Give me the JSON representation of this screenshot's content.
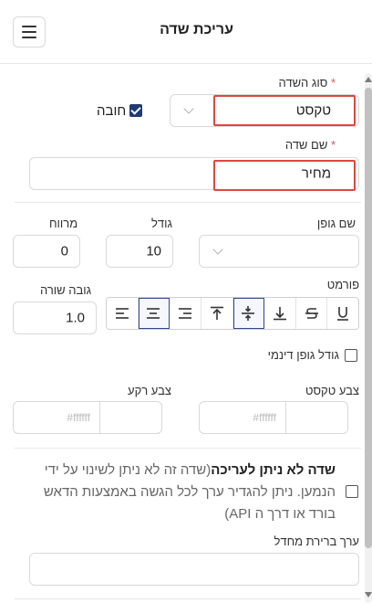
{
  "header": {
    "title": "עריכת שדה",
    "menu_icon": "hamburger-icon"
  },
  "field_type": {
    "label": "סוג השדה",
    "value": "טקסט",
    "required_label": "חובה",
    "required_checked": true
  },
  "field_name": {
    "label": "שם שדה",
    "value": "מחיר"
  },
  "font": {
    "family_label": "שם גופן",
    "size_label": "גודל",
    "size_value": "10",
    "spacing_label": "מרווח",
    "spacing_value": "0"
  },
  "format": {
    "label": "פורמט",
    "line_height_label": "גובה שורה",
    "line_height_value": "1.0",
    "buttons": [
      "underline-icon",
      "strikethrough-icon",
      "align-bottom-icon",
      "align-middle-icon",
      "align-top-icon",
      "align-right-icon",
      "align-center-icon",
      "align-left-icon"
    ],
    "active": [
      "align-middle-icon",
      "align-center-icon"
    ]
  },
  "dynamic_font": {
    "label": "גודל גופן דינמי",
    "checked": false
  },
  "colors": {
    "text_label": "צבע טקסט",
    "text_placeholder": "#ffffff",
    "bg_label": "צבע רקע",
    "bg_placeholder": "#ffffff"
  },
  "readonly": {
    "title": "שדה לא ניתן לעריכה",
    "description": "(שדה זה לא ניתן לשינוי על ידי הנמען. ניתן להגדיר ערך לכל הגשה באמצעות הדאש בורד או דרך ה API)",
    "checked": false
  },
  "default_value": {
    "label": "ערך ברירת מחדל",
    "value": ""
  },
  "theme": {
    "accent": "#1f3a74",
    "error": "#e0463f",
    "required_star": "#d9534f"
  }
}
